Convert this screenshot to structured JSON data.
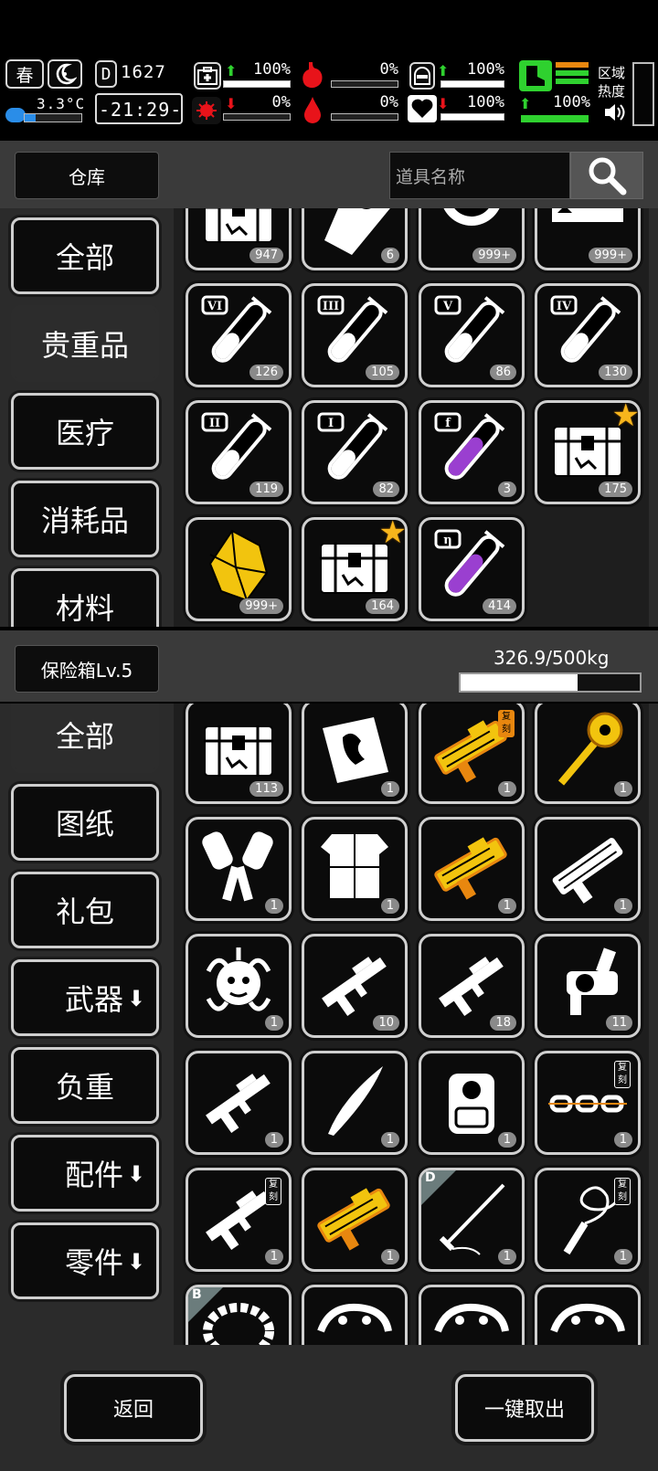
{
  "status": {
    "season": "春",
    "temperature": "3.3°C",
    "day_counter": "1627",
    "clock": "-21:29-",
    "health_pct": "100%",
    "infection_pct": "0%",
    "hunger_pct": "0%",
    "thirst_pct": "0%",
    "armor_pct": "100%",
    "mood_pct": "100%",
    "stamina_pct": "100%",
    "area_heat_label_1": "区域",
    "area_heat_label_2": "热度",
    "health_level": 1.0,
    "infection_level": 0.0,
    "hunger_level": 0.0,
    "thirst_level": 0.0,
    "armor_level": 1.0,
    "mood_level": 1.0,
    "stamina_level": 1.0
  },
  "warehouse": {
    "title": "仓库",
    "search_placeholder": "道具名称",
    "categories": [
      "全部",
      "贵重品",
      "医疗",
      "消耗品",
      "材料"
    ],
    "selected_category": "贵重品",
    "items": [
      {
        "count": "947",
        "icon": "chest-icon"
      },
      {
        "count": "6",
        "icon": "coin-card-icon"
      },
      {
        "count": "999+",
        "icon": "bitcoin-gear-icon"
      },
      {
        "count": "999+",
        "icon": "card-icon"
      },
      {
        "count": "126",
        "icon": "test-tube-vi-icon",
        "label": "VI"
      },
      {
        "count": "105",
        "icon": "test-tube-iii-icon",
        "label": "III"
      },
      {
        "count": "86",
        "icon": "test-tube-v-icon",
        "label": "V"
      },
      {
        "count": "130",
        "icon": "test-tube-iv-icon",
        "label": "IV"
      },
      {
        "count": "119",
        "icon": "test-tube-ii-icon",
        "label": "II"
      },
      {
        "count": "82",
        "icon": "test-tube-i-icon",
        "label": "I"
      },
      {
        "count": "3",
        "icon": "test-tube-f-icon",
        "label": "f"
      },
      {
        "count": "175",
        "icon": "starred-chest-icon"
      },
      {
        "count": "999+",
        "icon": "gold-crystal-icon"
      },
      {
        "count": "164",
        "icon": "starred-chest-icon"
      },
      {
        "count": "414",
        "icon": "test-tube-eta-icon",
        "label": "η"
      }
    ]
  },
  "safe": {
    "title": "保险箱Lv.5",
    "capacity": "326.9/500kg",
    "capacity_fraction": 0.654,
    "categories": [
      "全部",
      "图纸",
      "礼包",
      "武器",
      "负重",
      "配件",
      "零件"
    ],
    "selected_category": "全部",
    "copy_tag": "复刻",
    "items": [
      {
        "count": "113",
        "icon": "safe-chest-icon"
      },
      {
        "count": "1",
        "icon": "blueprint-icon"
      },
      {
        "count": "1",
        "icon": "gold-launcher-icon",
        "tag": "复刻"
      },
      {
        "count": "1",
        "icon": "gold-staff-icon"
      },
      {
        "count": "1",
        "icon": "gauntlets-icon"
      },
      {
        "count": "1",
        "icon": "body-armor-icon"
      },
      {
        "count": "1",
        "icon": "gold-rifle-icon"
      },
      {
        "count": "1",
        "icon": "heavy-gun-icon"
      },
      {
        "count": "1",
        "icon": "medusa-icon"
      },
      {
        "count": "10",
        "icon": "shotgun-icon"
      },
      {
        "count": "18",
        "icon": "assault-rifle-icon"
      },
      {
        "count": "11",
        "icon": "grenade-launcher-icon"
      },
      {
        "count": "1",
        "icon": "assault-rifle-icon"
      },
      {
        "count": "1",
        "icon": "blade-icon"
      },
      {
        "count": "1",
        "icon": "backpack-icon"
      },
      {
        "count": "1",
        "icon": "chain-icon",
        "tag": "复刻"
      },
      {
        "count": "1",
        "icon": "sniper-rifle-icon",
        "tag": "复刻"
      },
      {
        "count": "1",
        "icon": "gold-smg-icon"
      },
      {
        "count": "1",
        "icon": "sword-icon",
        "grade": "D"
      },
      {
        "count": "1",
        "icon": "whip-icon",
        "tag": "复刻"
      },
      {
        "count": "",
        "icon": "bracelet-icon",
        "grade": "B"
      },
      {
        "count": "",
        "icon": "dragon-icon"
      },
      {
        "count": "",
        "icon": "dragon-icon"
      },
      {
        "count": "",
        "icon": "dragon-icon"
      }
    ]
  },
  "buttons": {
    "back": "返回",
    "take_all": "一键取出"
  },
  "colors": {
    "accent_green": "#2fd12f",
    "alert_red": "#e8131a",
    "gold": "#f2c40e",
    "purple": "#9a3fd0",
    "orange": "#e8870f"
  }
}
